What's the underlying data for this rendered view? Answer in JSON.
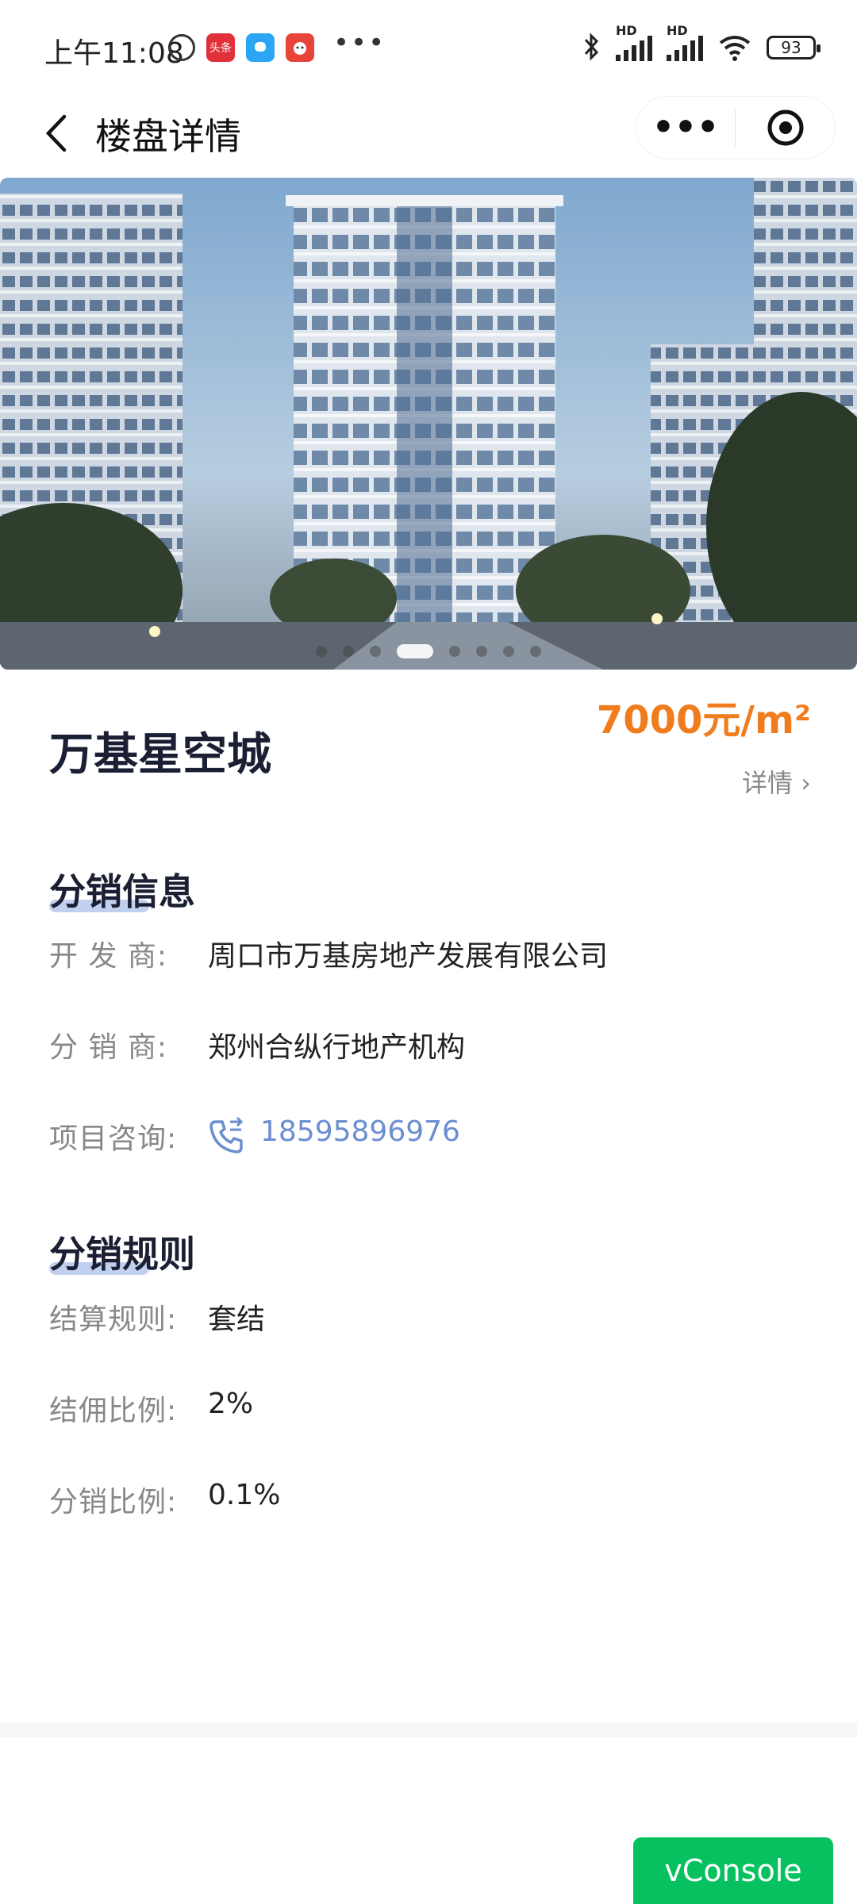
{
  "status_bar": {
    "time": "上午11:08",
    "app_badge_1": "头条",
    "battery": "93",
    "network_label_1": "HD",
    "network_label_2": "HD"
  },
  "nav": {
    "title": "楼盘详情",
    "more_label": "•••"
  },
  "banner": {
    "slide_count": 8,
    "active_slide": 4
  },
  "project": {
    "name": "万基星空城",
    "price": "7000元/m²",
    "detail_link": "详情 ›"
  },
  "distribution_info": {
    "title": "分销信息",
    "rows": [
      {
        "label": "开 发 商:",
        "value": "周口市万基房地产发展有限公司"
      },
      {
        "label": "分 销 商:",
        "value": "郑州合纵行地产机构"
      },
      {
        "label": "项目咨询:",
        "value": "18595896976"
      }
    ]
  },
  "distribution_rules": {
    "title": "分销规则",
    "rows": [
      {
        "label": "结算规则:",
        "value": "套结"
      },
      {
        "label": "结佣比例:",
        "value": "2%"
      },
      {
        "label": "分销比例:",
        "value": "0.1%"
      }
    ]
  },
  "vconsole": {
    "label": "vConsole"
  },
  "colors": {
    "price": "#ef7d1d",
    "phone": "#6a8ed0",
    "vconsole_bg": "#07c160"
  }
}
